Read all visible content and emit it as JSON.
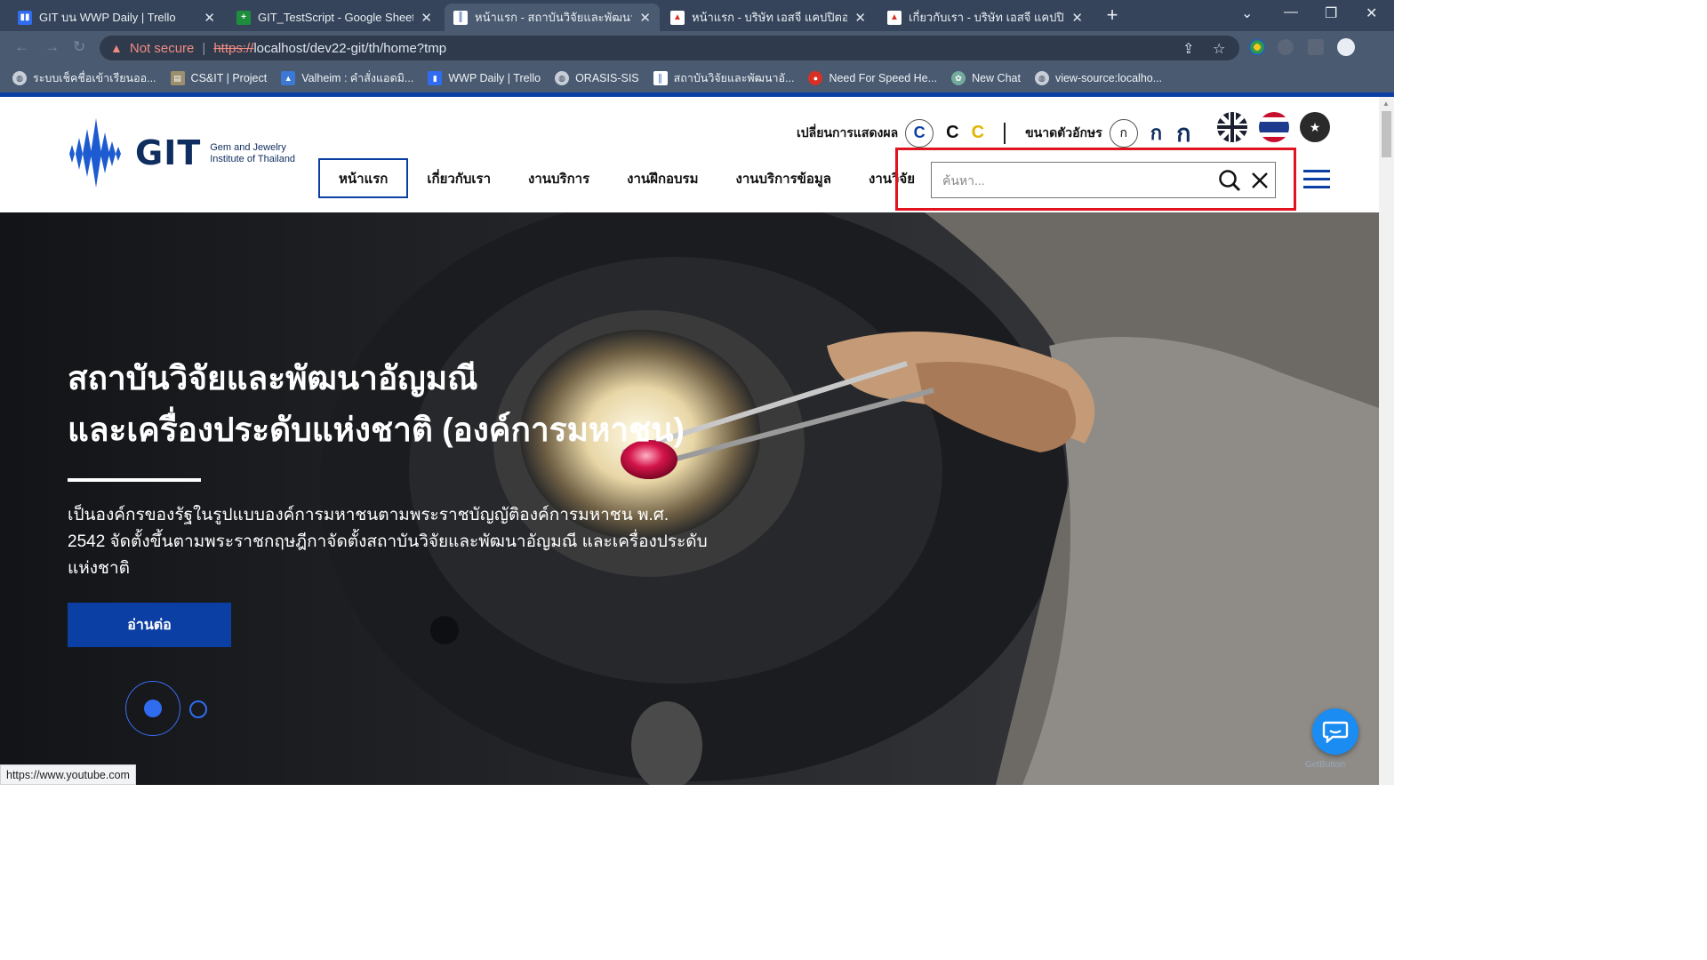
{
  "browser": {
    "tabs": [
      {
        "title": "GIT บน WWP Daily | Trello",
        "favicon": "trello-icon",
        "color": "#2f6cf0",
        "active": false
      },
      {
        "title": "GIT_TestScript - Google Sheets",
        "favicon": "sheets-icon",
        "color": "#1e8e3e",
        "active": false
      },
      {
        "title": "หน้าแรก - สถาบันวิจัยและพัฒนาอัญมณี",
        "favicon": "git-logo-icon",
        "color": "#0c3fa3",
        "active": true
      },
      {
        "title": "หน้าแรก - บริษัท เอสจี แคปปิตอล จำกัด",
        "favicon": "sg-logo-icon",
        "color": "#d93025",
        "active": false
      },
      {
        "title": "เกี่ยวกับเรา - บริษัท เอสจี แคปปิตอล จำกัด",
        "favicon": "sg-logo-icon",
        "color": "#d93025",
        "active": false
      }
    ],
    "not_secure": "Not secure",
    "url_scheme": "https://",
    "url_rest": "localhost/dev22-git/th/home?tmp",
    "bookmarks": [
      {
        "label": "ระบบเช็คชื่อเข้าเรียนออ...",
        "icon": "globe-icon",
        "color": "#c7ced8"
      },
      {
        "label": "CS&IT | Project",
        "icon": "project-icon",
        "color": "#9b8f6e"
      },
      {
        "label": "Valheim : คำสั่งแอดมิ...",
        "icon": "game-icon",
        "color": "#3c79d6"
      },
      {
        "label": "WWP Daily | Trello",
        "icon": "trello-icon",
        "color": "#2f6cf0"
      },
      {
        "label": "ORASIS-SIS",
        "icon": "globe-icon",
        "color": "#c7ced8"
      },
      {
        "label": "สถาบันวิจัยและพัฒนาอั...",
        "icon": "git-logo-icon",
        "color": "#0c3fa3"
      },
      {
        "label": "Need For Speed He...",
        "icon": "nfs-icon",
        "color": "#d93025"
      },
      {
        "label": "New Chat",
        "icon": "chat-ai-icon",
        "color": "#74aa9c"
      },
      {
        "label": "view-source:localho...",
        "icon": "globe-icon",
        "color": "#c7ced8"
      }
    ],
    "status_url": "https://www.youtube.com"
  },
  "site": {
    "logo_text": "GIT",
    "logo_sub_line1": "Gem and Jewelry",
    "logo_sub_line2": "Institute of Thailand",
    "display_label": "เปลี่ยนการแสดงผล",
    "contrast_options": [
      "C",
      "C",
      "C"
    ],
    "fontsize_label": "ขนาดตัวอักษร",
    "fontsize_options": [
      "ก",
      "ก",
      "ก"
    ],
    "nav": [
      "หน้าแรก",
      "เกี่ยวกับเรา",
      "งานบริการ",
      "งานฝึกอบรม",
      "งานบริการข้อมูล",
      "งานวิจัย"
    ],
    "search_placeholder": "ค้นหา...",
    "accent": "#0c3fa3",
    "highlight": "#e0131f"
  },
  "hero": {
    "title_line1": "สถาบันวิจัยและพัฒนาอัญมณี",
    "title_line2": "และเครื่องประดับแห่งชาติ (องค์การมหาชน)",
    "description": "เป็นองค์กรของรัฐในรูปแบบองค์การมหาชนตามพระราชบัญญัติองค์การมหาชน พ.ศ. 2542 จัดตั้งขึ้นตามพระราชกฤษฎีกาจัดตั้งสถาบันวิจัยและพัฒนาอัญมณี และเครื่องประดับแห่งชาติ",
    "button": "อ่านต่อ"
  },
  "widget": {
    "getbutton": "GetButton"
  }
}
